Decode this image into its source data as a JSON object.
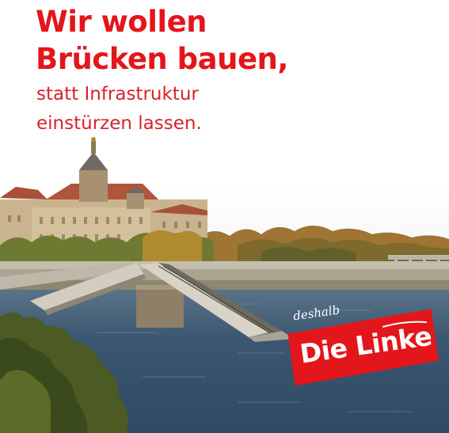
{
  "headline": {
    "line1": "Wir wollen",
    "line2": "Brücken bauen,"
  },
  "subline": {
    "line1": "statt Infrastruktur",
    "line2": "einstürzen lassen."
  },
  "badge": {
    "tag": "deshalb",
    "brand": "Die Linke"
  },
  "colors": {
    "accent_red": "#e3161b",
    "subline_red": "#d8232a",
    "water": "#3b5670",
    "text_white": "#ffffff"
  },
  "icons": {
    "scene": "collapsed-bridge-photo",
    "badge": "die-linke-logo"
  }
}
